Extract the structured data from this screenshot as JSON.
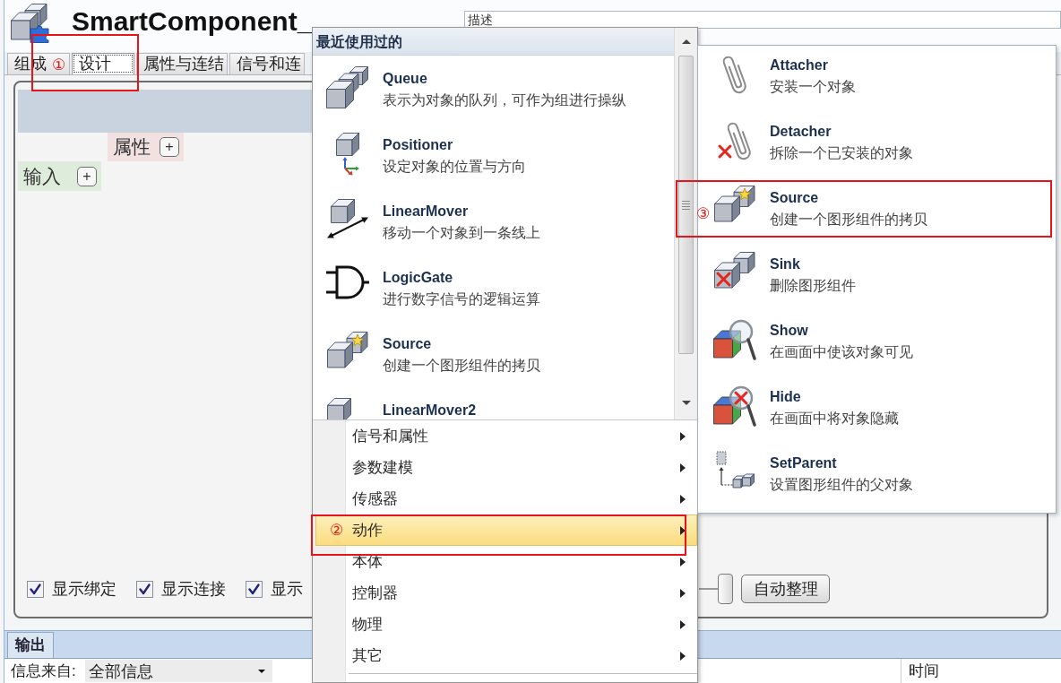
{
  "window": {
    "title": "SmartComponent_"
  },
  "description_field": {
    "label": "描述"
  },
  "tabs": [
    {
      "label": "组成",
      "selected": false
    },
    {
      "label": "设计",
      "selected": true
    },
    {
      "label": "属性与连结",
      "selected": false
    },
    {
      "label": "信号和连",
      "selected": false
    }
  ],
  "designer": {
    "properties": {
      "label": "属性",
      "add": "+"
    },
    "inputs": {
      "label": "输入",
      "add": "+"
    },
    "options": [
      {
        "label": "显示绑定",
        "checked": true
      },
      {
        "label": "显示连接",
        "checked": true
      },
      {
        "label": "显示",
        "checked": true
      }
    ],
    "zoom_slider": {
      "level": 1
    },
    "auto_arrange_button": "自动整理"
  },
  "output": {
    "tab": "输出",
    "filter_label": "信息来自:",
    "filter_value": "全部信息",
    "columns": [
      "时间"
    ]
  },
  "add_menu": {
    "recent_header": "最近使用过的",
    "recent": [
      {
        "kind": "queue",
        "title": "Queue",
        "description": "表示为对象的队列，可作为组进行操纵"
      },
      {
        "kind": "positioner",
        "title": "Positioner",
        "description": "设定对象的位置与方向"
      },
      {
        "kind": "mover",
        "title": "LinearMover",
        "description": "移动一个对象到一条线上"
      },
      {
        "kind": "gate",
        "title": "LogicGate",
        "description": "进行数字信号的逻辑运算"
      },
      {
        "kind": "source",
        "title": "Source",
        "description": "创建一个图形组件的拷贝"
      },
      {
        "kind": "mover",
        "title": "LinearMover2"
      }
    ],
    "categories": [
      {
        "label": "信号和属性",
        "selected": false,
        "submenu": true
      },
      {
        "label": "参数建模",
        "selected": false,
        "submenu": true
      },
      {
        "label": "传感器",
        "selected": false,
        "submenu": true
      },
      {
        "label": "动作",
        "selected": true,
        "submenu": true
      },
      {
        "label": "本体",
        "selected": false,
        "submenu": true
      },
      {
        "label": "控制器",
        "selected": false,
        "submenu": true
      },
      {
        "label": "物理",
        "selected": false,
        "submenu": true
      },
      {
        "label": "其它",
        "selected": false,
        "submenu": true
      }
    ]
  },
  "actions_submenu": [
    {
      "kind": "attach",
      "title": "Attacher",
      "description": "安装一个对象"
    },
    {
      "kind": "detach",
      "title": "Detacher",
      "description": "拆除一个已安装的对象"
    },
    {
      "kind": "source",
      "title": "Source",
      "description": "创建一个图形组件的拷贝"
    },
    {
      "kind": "sink",
      "title": "Sink",
      "description": "删除图形组件"
    },
    {
      "kind": "show",
      "title": "Show",
      "description": "在画面中使该对象可见"
    },
    {
      "kind": "hide",
      "title": "Hide",
      "description": "在画面中将对象隐藏"
    },
    {
      "kind": "parent",
      "title": "SetParent",
      "description": "设置图形组件的父对象"
    }
  ],
  "annotations": [
    {
      "number": "①"
    },
    {
      "number": "②"
    },
    {
      "number": "③"
    }
  ]
}
